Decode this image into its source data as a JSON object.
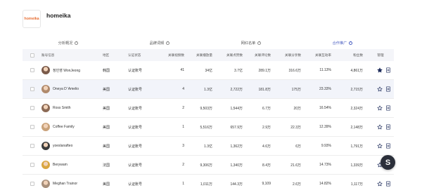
{
  "header": {
    "logo_text": "homeika",
    "brand_name": "homeika"
  },
  "tabs": [
    {
      "label": "分析概况",
      "active": false
    },
    {
      "label": "品牌词频",
      "active": false
    },
    {
      "label": "网红名单",
      "active": false
    },
    {
      "label": "合作推广",
      "active": true
    }
  ],
  "columns": [
    "账号信息",
    "地区",
    "认证状态",
    "关联视频数",
    "关联播放量",
    "关联点赞数",
    "关联评论数",
    "关联分享数",
    "关联互动率",
    "粉丝数",
    "管理"
  ],
  "rows": [
    {
      "name": "정민영 WonJeong",
      "region": "韩国",
      "status": "认证账号",
      "videos": "41",
      "plays": "34亿",
      "likes": "3.7亿",
      "comments": "289.1万",
      "shares": "316.6万",
      "rate": "11.13%",
      "fans": "4,861万",
      "avatar_color": "#7a5a4a",
      "starred": true
    },
    {
      "name": "Oneya D' Amelio",
      "region": "美国",
      "status": "认证账号",
      "videos": "4",
      "plays": "1.3亿",
      "likes": "2,722万",
      "comments": "181.8万",
      "shares": "175万",
      "rate": "23.33%",
      "fans": "2,715万",
      "avatar_color": "#b08a6c",
      "starred": false
    },
    {
      "name": "Ross Smith",
      "region": "美国",
      "status": "认证账号",
      "videos": "2",
      "plays": "9,503万",
      "likes": "1,544万",
      "comments": "6.7万",
      "shares": "20万",
      "rate": "16.54%",
      "fans": "2,324万",
      "avatar_color": "#8c6a55",
      "starred": false
    },
    {
      "name": "Coffee Family",
      "region": "美国",
      "status": "认证账号",
      "videos": "1",
      "plays": "5,516万",
      "likes": "657.9万",
      "comments": "2.9万",
      "shares": "22.3万",
      "rate": "12.39%",
      "fans": "2,148万",
      "avatar_color": "#c9a27a",
      "starred": false
    },
    {
      "name": "yoeslanafteo",
      "region": "美国",
      "status": "认证账号",
      "videos": "3",
      "plays": "1.3亿",
      "likes": "1,362万",
      "comments": "4.6万",
      "shares": "6万",
      "rate": "9.93%",
      "fans": "1,791万",
      "avatar_color": "#3b3b3b",
      "starred": false
    },
    {
      "name": "Berywam",
      "region": "法国",
      "status": "认证账号",
      "videos": "2",
      "plays": "9,306万",
      "likes": "1,340万",
      "comments": "8.4万",
      "shares": "21.6万",
      "rate": "14.73%",
      "fans": "1,339万",
      "avatar_color": "#d9a640",
      "starred": false
    },
    {
      "name": "Meghan Trainor",
      "region": "美国",
      "status": "认证账号",
      "videos": "1",
      "plays": "1,011万",
      "likes": "144.3万",
      "comments": "9,109",
      "shares": "2.6万",
      "rate": "14.82%",
      "fans": "1,117万",
      "avatar_color": "#a88f7a",
      "starred": false
    }
  ],
  "colors": {
    "accent": "#4a5fc1",
    "row_highlight": "#f2f4fa",
    "header_bg": "#f4f5f9",
    "star_filled": "#1f2d5c"
  },
  "icons": {
    "star": "star-icon",
    "add_to_list": "add-list-icon",
    "fab": "s-chat-icon"
  },
  "fab": {
    "label": "S"
  }
}
